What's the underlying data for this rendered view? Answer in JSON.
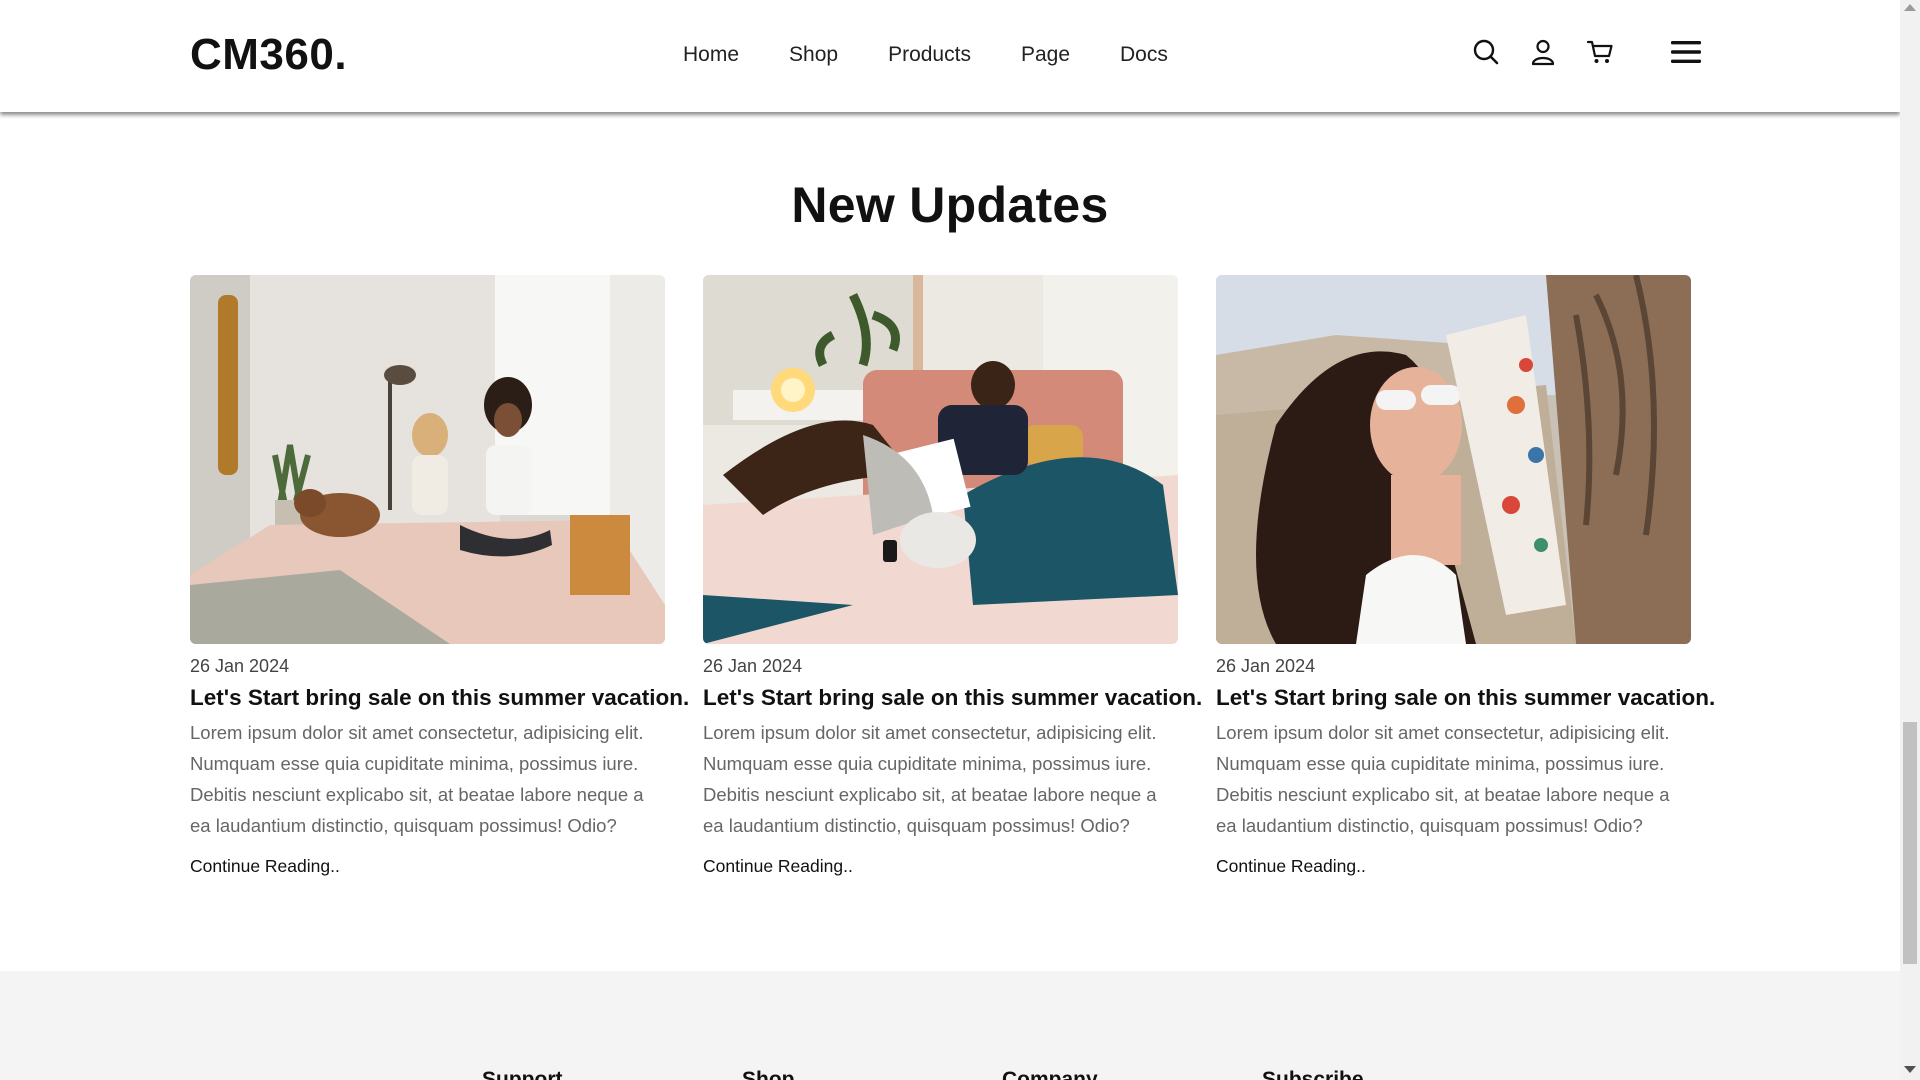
{
  "header": {
    "logo": "CM360.",
    "nav": [
      "Home",
      "Shop",
      "Products",
      "Page",
      "Docs"
    ],
    "icons": [
      "search-icon",
      "user-icon",
      "cart-icon",
      "hamburger-menu-icon"
    ]
  },
  "section": {
    "title": "New Updates"
  },
  "posts": [
    {
      "image": "friends-on-bed-with-dog",
      "date": "26 Jan 2024",
      "title": "Let's Start bring sale on this summer vacation.",
      "body": "Lorem ipsum dolor sit amet consectetur, adipisicing elit. Numquam esse quia cupiditate minima, possimus iure. Debitis nesciunt explicabo sit, at beatae labore neque a ea laudantium distinctio, quisquam possimus! Odio?",
      "link": "Continue Reading.."
    },
    {
      "image": "man-reading-on-bed",
      "date": "26 Jan 2024",
      "title": "Let's Start bring sale on this summer vacation.",
      "body": "Lorem ipsum dolor sit amet consectetur, adipisicing elit. Numquam esse quia cupiditate minima, possimus iure. Debitis nesciunt explicabo sit, at beatae labore neque a ea laudantium distinctio, quisquam possimus! Odio?",
      "link": "Continue Reading.."
    },
    {
      "image": "woman-in-sunglasses-summer",
      "date": "26 Jan 2024",
      "title": "Let's Start bring sale on this summer vacation.",
      "body": "Lorem ipsum dolor sit amet consectetur, adipisicing elit. Numquam esse quia cupiditate minima, possimus iure. Debitis nesciunt explicabo sit, at beatae labore neque a ea laudantium distinctio, quisquam possimus! Odio?",
      "link": "Continue Reading.."
    }
  ],
  "footer": {
    "columns": [
      "Support",
      "Shop",
      "Company",
      "Subscribe"
    ]
  }
}
